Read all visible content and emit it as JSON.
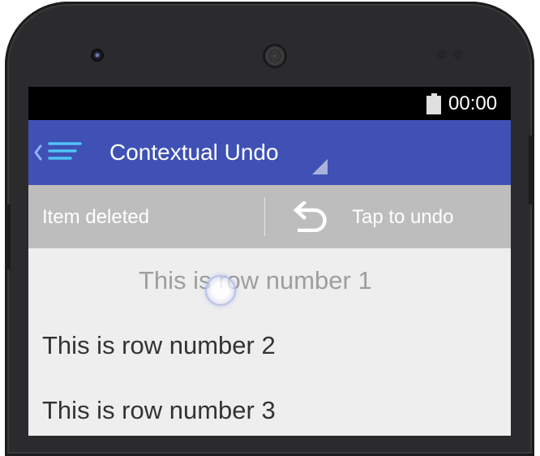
{
  "status_bar": {
    "time": "00:00",
    "battery_icon": "battery-full-icon"
  },
  "app_bar": {
    "title": "Contextual Undo",
    "background_color": "#3f51b5",
    "nav_icon": "back-menu-icon",
    "spinner_icon": "spinner-dropdown-triangle-icon"
  },
  "undo_bar": {
    "message": "Item deleted",
    "action_label": "Tap to undo",
    "action_icon": "undo-arrow-icon",
    "background_color": "#bdbdbd"
  },
  "list": {
    "rows": [
      {
        "text": "This is row number 1"
      },
      {
        "text": "This is row number 2"
      },
      {
        "text": "This is row number 3"
      }
    ]
  }
}
